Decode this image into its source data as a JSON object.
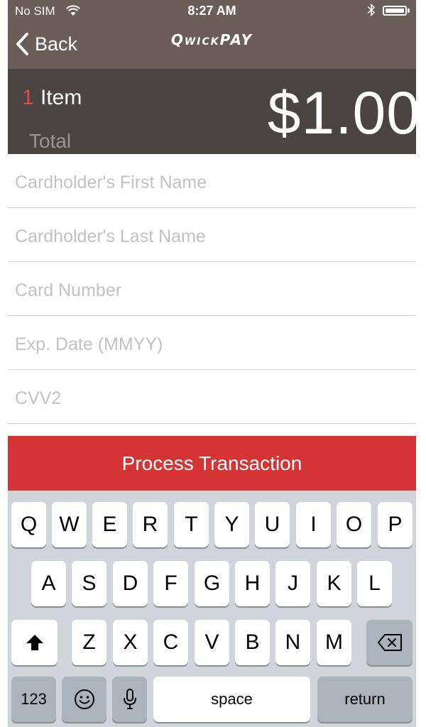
{
  "status_bar": {
    "carrier": "No SIM",
    "time": "8:27 AM"
  },
  "nav": {
    "back_label": "Back",
    "logo_text": "QwickPAY"
  },
  "summary": {
    "item_count": "1",
    "item_label": "Item",
    "total_label": "Total",
    "amount": "$1.00"
  },
  "form": {
    "first_name_placeholder": "Cardholder's First Name",
    "last_name_placeholder": "Cardholder's Last Name",
    "card_number_placeholder": "Card Number",
    "exp_date_placeholder": "Exp. Date (MMYY)",
    "cvv_placeholder": "CVV2"
  },
  "process_button_label": "Process Transaction",
  "colors": {
    "nav_bg": "#6b5e5a",
    "summary_bg": "#4a4442",
    "accent_red": "#d63434",
    "item_count_red": "#e04a4a",
    "keyboard_bg": "#d1d5db"
  },
  "keyboard": {
    "row1": [
      "Q",
      "W",
      "E",
      "R",
      "T",
      "Y",
      "U",
      "I",
      "O",
      "P"
    ],
    "row2": [
      "A",
      "S",
      "D",
      "F",
      "G",
      "H",
      "J",
      "K",
      "L"
    ],
    "row3": [
      "Z",
      "X",
      "C",
      "V",
      "B",
      "N",
      "M"
    ],
    "numbers_label": "123",
    "space_label": "space",
    "return_label": "return"
  }
}
